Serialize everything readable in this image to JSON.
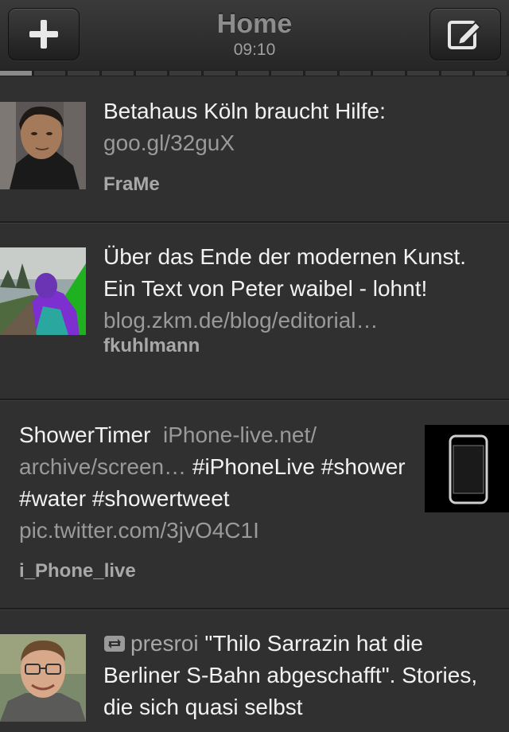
{
  "header": {
    "title": "Home",
    "time": "09:10",
    "left_button": "plus-icon",
    "right_button": "compose-icon"
  },
  "tweets": [
    {
      "text": "Betahaus Köln braucht Hilfe:",
      "link": "goo.gl/32guX",
      "user": "FraMe"
    },
    {
      "text": "Über das Ende der modernen Kunst. Ein Text von Peter waibel - lohnt!",
      "link": "blog.zkm.de/blog/editorial…",
      "user": "fkuhlmann"
    },
    {
      "text_a": "ShowerTimer",
      "link": "iPhone-live.net/ archive/screen…",
      "text_b": "#iPhoneLive #shower #water #showertweet",
      "pic": "pic.twitter.com/3jvO4C1I",
      "user": "i_Phone_live"
    },
    {
      "rt_user": "presroi",
      "text": "\"Thilo Sarrazin hat die Berliner S-Bahn abgeschafft\". Stories, die sich quasi selbst"
    }
  ],
  "colors": {
    "background": "#303030",
    "text": "#f2f2f2",
    "link": "#9a9a9a",
    "username": "#a8a8a8"
  }
}
